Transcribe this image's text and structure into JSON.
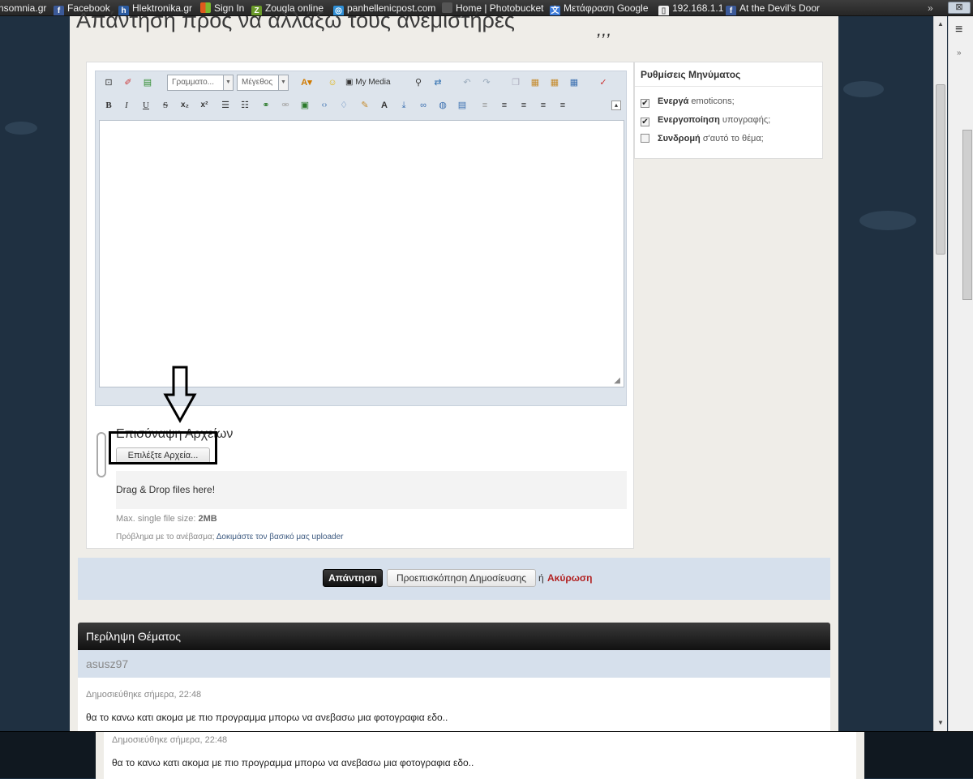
{
  "bookmarks": [
    {
      "label": "nsomnia.gr",
      "icon": "none"
    },
    {
      "label": "Facebook",
      "icon": "facebook-icon",
      "color": "#3b5998"
    },
    {
      "label": "Hlektronika.gr",
      "icon": "h-icon",
      "color": "#2a5aa0"
    },
    {
      "label": "Sign In",
      "icon": "windows-icon",
      "color": "#e05a1d"
    },
    {
      "label": "Zougla online",
      "icon": "z-icon",
      "color": "#6a9a2a"
    },
    {
      "label": "panhellenicpost.com",
      "icon": "globe-icon",
      "color": "#2f8fd6"
    },
    {
      "label": "Home | Photobucket",
      "icon": "photobucket-icon",
      "color": "#444"
    },
    {
      "label": "Μετάφραση Google",
      "icon": "translate-icon",
      "color": "#3d7bd8"
    },
    {
      "label": "192.168.1.1",
      "icon": "page-icon",
      "color": "#ddd"
    },
    {
      "label": "At the Devil's Door",
      "icon": "facebook-icon",
      "color": "#3b5998"
    }
  ],
  "bookmarks_more": "»",
  "page": {
    "title": "Απάντηση προς να αλλάξω τους ανεμιστήρες",
    "quote_marks": ",,,"
  },
  "editor": {
    "font_select": "Γραμματο...",
    "size_select": "Μέγεθος",
    "my_media": "My Media",
    "toolbar_row1": [
      "source-icon",
      "eraser-icon",
      "table-icon",
      "font-color-icon",
      "smiley-icon",
      "my-media-icon",
      "find-icon",
      "replace-icon",
      "undo-icon",
      "redo-icon",
      "copy-icon",
      "paste-icon",
      "paste-text-icon",
      "paste-word-icon",
      "spellcheck-icon"
    ],
    "toolbar_row2": [
      {
        "name": "bold-icon",
        "glyph": "B"
      },
      {
        "name": "italic-icon",
        "glyph": "I"
      },
      {
        "name": "underline-icon",
        "glyph": "U"
      },
      {
        "name": "strike-icon",
        "glyph": "S"
      },
      {
        "name": "subscript-icon",
        "glyph": "x₂"
      },
      {
        "name": "superscript-icon",
        "glyph": "x²"
      },
      {
        "name": "bullet-list-icon",
        "glyph": "☰"
      },
      {
        "name": "numbered-list-icon",
        "glyph": "☷"
      },
      {
        "name": "link-icon",
        "glyph": "⚭"
      },
      {
        "name": "unlink-icon",
        "glyph": "⚮"
      },
      {
        "name": "image-icon",
        "glyph": "▣"
      },
      {
        "name": "code-icon",
        "glyph": "‹›"
      },
      {
        "name": "quote-icon",
        "glyph": "♢"
      },
      {
        "name": "highlight-icon",
        "glyph": "✎"
      },
      {
        "name": "font-size-icon",
        "glyph": "A"
      },
      {
        "name": "download-icon",
        "glyph": "⤓"
      },
      {
        "name": "hyperlink-icon",
        "glyph": "∞"
      },
      {
        "name": "globe-icon",
        "glyph": "◍"
      },
      {
        "name": "flash-icon",
        "glyph": "▤"
      },
      {
        "name": "indent-icon",
        "glyph": "≡"
      },
      {
        "name": "outdent-icon",
        "glyph": "≡"
      },
      {
        "name": "align-left-icon",
        "glyph": "≡"
      },
      {
        "name": "align-center-icon",
        "glyph": "≡"
      },
      {
        "name": "align-right-icon",
        "glyph": "≡"
      }
    ],
    "collapse": "▴"
  },
  "attachments": {
    "label": "Επισύναψη Αρχείων",
    "choose_button": "Επιλέξτε Αρχεία...",
    "drop_zone": "Drag & Drop files here!",
    "max_size_label": "Max. single file size: ",
    "max_size_value": "2MB",
    "problem_text": "Πρόβλημα με το ανέβασμα; ",
    "problem_link": "Δοκιμάστε τον βασικό μας uploader"
  },
  "options": {
    "title": "Ρυθμίσεις Μηνύματος",
    "items": [
      {
        "bold": "Ενεργά",
        "rest": " emoticons;",
        "checked": "✔"
      },
      {
        "bold": "Ενεργοποίηση",
        "rest": " υπογραφής;",
        "checked": "✔"
      },
      {
        "bold": "Συνδρομή",
        "rest": " σ'αυτό το θέμα;",
        "checked": ""
      }
    ]
  },
  "actions": {
    "reply": "Απάντηση",
    "preview": "Προεπισκόπηση Δημοσίευσης",
    "or": "ή",
    "cancel": "Ακύρωση"
  },
  "summary": {
    "title": "Περίληψη Θέματος",
    "user": "asusz97",
    "posted": "Δημοσιεύθηκε σήμερα, 22:48",
    "text": "θα το κανω  κατι ακομα  με πιο προγραμμα  μπορω να ανεβασω μια φοτογραφια εδο.."
  },
  "scroll": {
    "up": "▲",
    "down": "▼"
  },
  "sidebar": {
    "menu": "≡",
    "more": "»"
  },
  "window_button": "⊠",
  "colors": {
    "accent_dark": "#111111",
    "cancel_red": "#b22222",
    "panel_blue": "#d6e0ec"
  }
}
